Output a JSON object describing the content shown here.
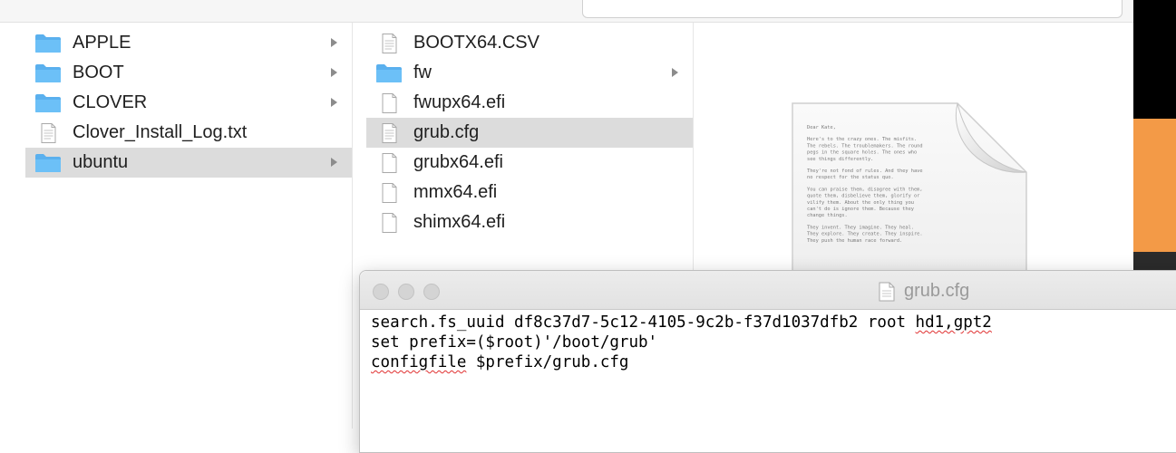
{
  "columns": {
    "left": [
      {
        "label": "APPLE",
        "type": "folder",
        "has_children": true,
        "selected": false
      },
      {
        "label": "BOOT",
        "type": "folder",
        "has_children": true,
        "selected": false
      },
      {
        "label": "CLOVER",
        "type": "folder",
        "has_children": true,
        "selected": false
      },
      {
        "label": "Clover_Install_Log.txt",
        "type": "text-file",
        "has_children": false,
        "selected": false
      },
      {
        "label": "ubuntu",
        "type": "folder",
        "has_children": true,
        "selected": true
      }
    ],
    "middle": [
      {
        "label": "BOOTX64.CSV",
        "type": "text-file",
        "has_children": false,
        "selected": false
      },
      {
        "label": "fw",
        "type": "folder",
        "has_children": true,
        "selected": false
      },
      {
        "label": "fwupx64.efi",
        "type": "file",
        "has_children": false,
        "selected": false
      },
      {
        "label": "grub.cfg",
        "type": "text-file",
        "has_children": false,
        "selected": true
      },
      {
        "label": "grubx64.efi",
        "type": "file",
        "has_children": false,
        "selected": false
      },
      {
        "label": "mmx64.efi",
        "type": "file",
        "has_children": false,
        "selected": false
      },
      {
        "label": "shimx64.efi",
        "type": "file",
        "has_children": false,
        "selected": false
      }
    ]
  },
  "preview": {
    "icon": "text-document-icon",
    "lines": [
      "Dear Kate,",
      "Here's to the crazy ones. The misfits. The rebels. The troublemakers. The round pegs in the square holes. The ones who see things differently.",
      "They're not fond of rules. And they have no respect for the status quo.",
      "You can praise them, disagree with them, quote them, disbelieve them, glorify or vilify them. About the only thing you can't do is ignore them. Because they change things.",
      "They invent. They imagine. They heal. They explore. They create. They inspire. They push the human race forward."
    ]
  },
  "editor": {
    "title": "grub.cfg",
    "lines": [
      {
        "pre": "search.fs_uuid df8c37d7-5c12-4105-9c2b-f37d1037dfb2 root ",
        "err": "hd1,gpt2",
        "post": ""
      },
      {
        "pre": "set prefix=($root)'/boot/grub'",
        "err": "",
        "post": ""
      },
      {
        "pre": "",
        "err": "configfile",
        "post": " $prefix/grub.cfg"
      }
    ]
  },
  "colors": {
    "selection": "#dcdcdc",
    "folder": "#5ab0ee",
    "accent_orange": "#f39a47"
  }
}
